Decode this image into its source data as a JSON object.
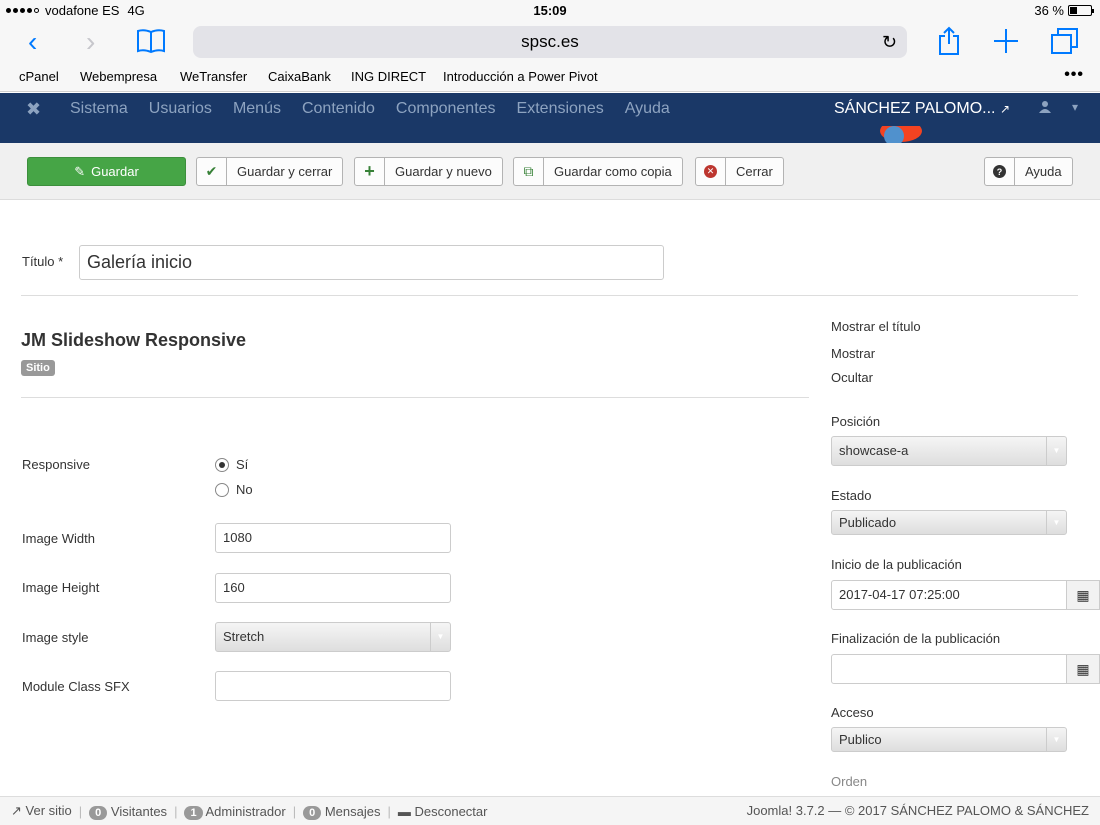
{
  "status_bar": {
    "carrier": "vodafone ES",
    "network": "4G",
    "time": "15:09",
    "battery": "36 %",
    "battery_level": 0.36
  },
  "browser": {
    "url": "spsc.es",
    "bookmarks": [
      "cPanel",
      "Webempresa",
      "WeTransfer",
      "CaixaBank",
      "ING DIRECT",
      "Introducción a Power Pivot"
    ]
  },
  "admin_nav": {
    "menu": [
      "Sistema",
      "Usuarios",
      "Menús",
      "Contenido",
      "Componentes",
      "Extensiones",
      "Ayuda"
    ],
    "site_user": "SÁNCHEZ PALOMO..."
  },
  "toolbar": {
    "save": "Guardar",
    "save_close": "Guardar y cerrar",
    "save_new": "Guardar y nuevo",
    "save_copy": "Guardar como copia",
    "close": "Cerrar",
    "help": "Ayuda"
  },
  "form": {
    "title_label": "Título *",
    "title_value": "Galería inicio",
    "module_name": "JM Slideshow Responsive",
    "badge": "Sitio",
    "responsive_label": "Responsive",
    "responsive_yes": "Sí",
    "responsive_no": "No",
    "image_width_label": "Image Width",
    "image_width_value": "1080",
    "image_height_label": "Image Height",
    "image_height_value": "160",
    "image_style_label": "Image style",
    "image_style_value": "Stretch",
    "module_class_label": "Module Class SFX",
    "module_class_value": ""
  },
  "sidebar": {
    "show_title_label": "Mostrar el título",
    "show_option": "Mostrar",
    "hide_option": "Ocultar",
    "position_label": "Posición",
    "position_value": "showcase-a",
    "state_label": "Estado",
    "state_value": "Publicado",
    "publish_start_label": "Inicio de la publicación",
    "publish_start_value": "2017-04-17 07:25:00",
    "publish_end_label": "Finalización de la publicación",
    "publish_end_value": "",
    "access_label": "Acceso",
    "access_value": "Publico",
    "order_label": "Orden"
  },
  "footer": {
    "view_site": "Ver sitio",
    "visitors_count": "0",
    "visitors": "Visitantes",
    "admin_count": "1",
    "admin": "Administrador",
    "messages_count": "0",
    "messages": "Mensajes",
    "logout": "Desconectar",
    "copyright": "Joomla! 3.7.2 — © 2017 SÁNCHEZ PALOMO & SÁNCHEZ"
  }
}
